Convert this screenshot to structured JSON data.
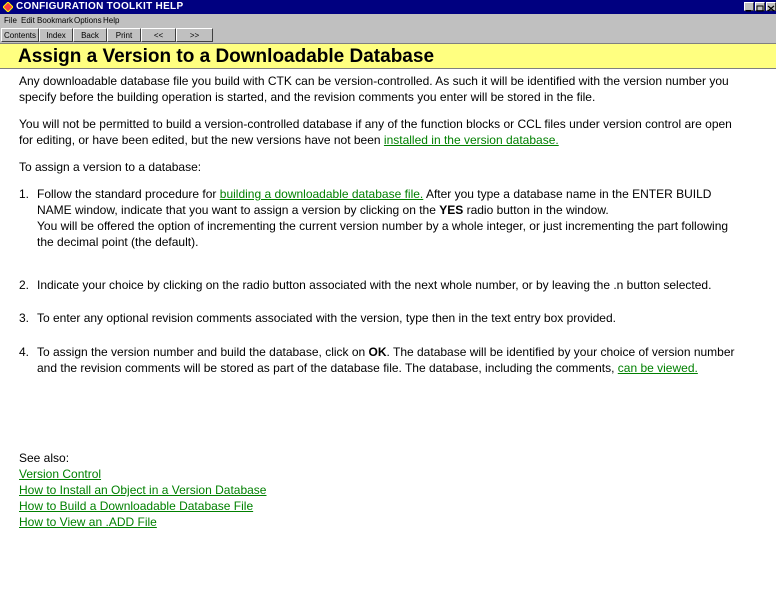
{
  "window": {
    "title": "CONFIGURATION TOOLKIT HELP",
    "icon": "app-diamond-icon"
  },
  "menu": [
    {
      "label": "File"
    },
    {
      "label": "Edit"
    },
    {
      "label": "Bookmark"
    },
    {
      "label": "Options"
    },
    {
      "label": "Help"
    }
  ],
  "toolbar": {
    "buttons": [
      "Contents",
      "Index",
      "Back",
      "Print",
      "<<",
      ">>"
    ]
  },
  "topic": {
    "title": "Assign a Version to a Downloadable Database"
  },
  "content": {
    "p1_line1": "Any downloadable database file you build with CTK can be version-controlled.  As such it will be identified with the version number you",
    "p1_line2": "specify before the building operation is started, and the revision comments you enter will be stored in the file.",
    "p2_line1": "You will not be permitted to build a version-controlled database if any of the function blocks or CCL files under version control are open",
    "p2_line2_pre": "for editing, or have been edited, but the new versions have not been ",
    "p2_link": "installed in the version database.",
    "p3": "To assign a version to a database:",
    "step1_num": "1.",
    "step1_pre": "Follow the standard procedure for ",
    "step1_link": "building a downloadable database file.",
    "step1_post": "  After you type a database name in the ENTER BUILD",
    "step1_line2_pre": "NAME window, indicate that you want to assign a version by clicking on the ",
    "step1_line2_bold": "YES",
    "step1_line2_post": " radio button in the window.",
    "step1_line3": "You will be offered the option of incrementing the current version number by a whole integer, or just incrementing the part following",
    "step1_line4": "the decimal point (the default).",
    "step2_num": "2.",
    "step2": "Indicate your choice by clicking on the radio button associated with the next whole number, or by leaving the .n button selected.",
    "step3_num": "3.",
    "step3": "To enter any optional revision comments associated with the version, type then in the text entry box provided.",
    "step4_num": "4.",
    "step4_line1_pre": "To assign the version number and build the database, click on ",
    "step4_line1_bold": "OK",
    "step4_line1_post": ".  The database will be identified by your choice of version number",
    "step4_line2_pre": "and the revision comments will be stored as part of the database file.  The database, including the comments, ",
    "step4_link": "can be viewed.",
    "see_also": "See also:",
    "links": [
      "Version Control",
      "How to Install an Object in a Version Database",
      "How to Build a Downloadable Database File",
      "How to View an .ADD File"
    ]
  },
  "colors": {
    "titlebar": "#000080",
    "header_bg": "#ffff80",
    "link": "#008000",
    "chrome": "#c0c0c0"
  }
}
